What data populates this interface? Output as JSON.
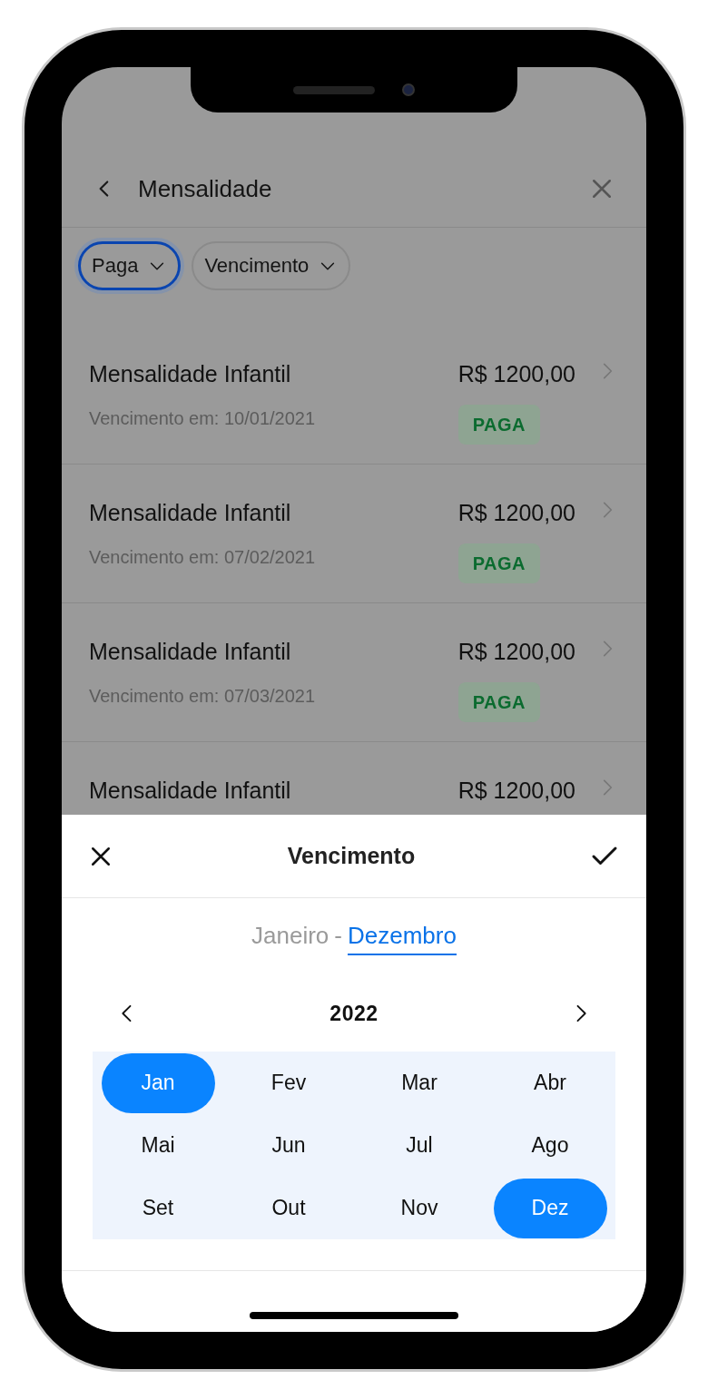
{
  "header": {
    "title": "Mensalidade"
  },
  "filters": [
    {
      "label": "Paga",
      "selected": true
    },
    {
      "label": "Vencimento",
      "selected": false
    }
  ],
  "items": [
    {
      "title": "Mensalidade Infantil",
      "amount": "R$ 1200,00",
      "due": "Vencimento em: 10/01/2021",
      "status": "PAGA"
    },
    {
      "title": "Mensalidade Infantil",
      "amount": "R$ 1200,00",
      "due": "Vencimento em: 07/02/2021",
      "status": "PAGA"
    },
    {
      "title": "Mensalidade Infantil",
      "amount": "R$ 1200,00",
      "due": "Vencimento em: 07/03/2021",
      "status": "PAGA"
    },
    {
      "title": "Mensalidade Infantil",
      "amount": "R$ 1200,00"
    }
  ],
  "sheet": {
    "title": "Vencimento",
    "range": {
      "start": {
        "label": "Janeiro",
        "selected": false
      },
      "separator": "-",
      "end": {
        "label": "Dezembro",
        "selected": true
      }
    },
    "year": "2022",
    "months": [
      {
        "label": "Jan",
        "selected": true
      },
      {
        "label": "Fev",
        "selected": false
      },
      {
        "label": "Mar",
        "selected": false
      },
      {
        "label": "Abr",
        "selected": false
      },
      {
        "label": "Mai",
        "selected": false
      },
      {
        "label": "Jun",
        "selected": false
      },
      {
        "label": "Jul",
        "selected": false
      },
      {
        "label": "Ago",
        "selected": false
      },
      {
        "label": "Set",
        "selected": false
      },
      {
        "label": "Out",
        "selected": false
      },
      {
        "label": "Nov",
        "selected": false
      },
      {
        "label": "Dez",
        "selected": true
      }
    ]
  }
}
